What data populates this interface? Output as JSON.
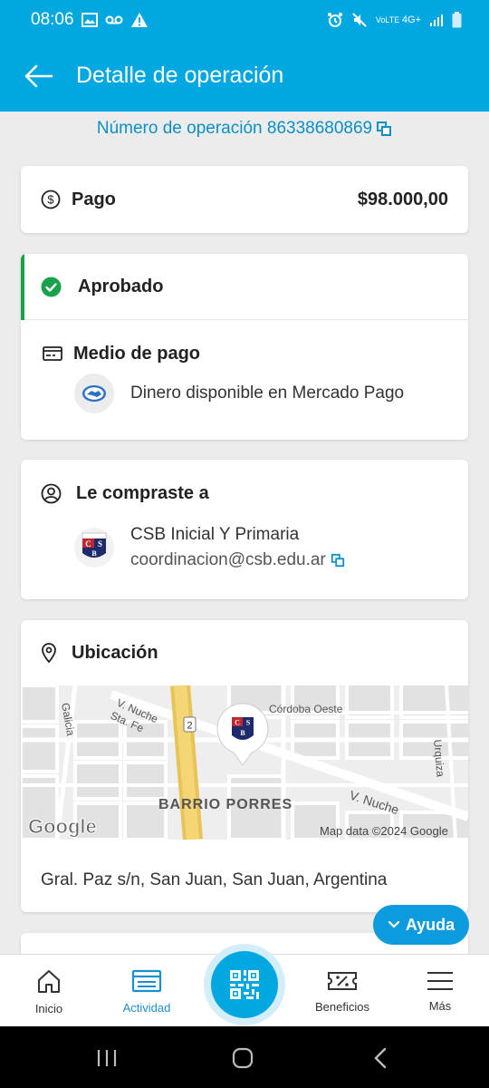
{
  "status_bar": {
    "time": "08:06",
    "network": "4G+",
    "volte": "VoLTE"
  },
  "header": {
    "title": "Detalle de operación"
  },
  "operation": {
    "number_text": "Número de operación 86338680869"
  },
  "payment": {
    "label": "Pago",
    "amount": "$98.000,00"
  },
  "status": {
    "label": "Aprobado",
    "method_title": "Medio de pago",
    "method_value": "Dinero disponible en Mercado Pago"
  },
  "seller": {
    "title": "Le compraste a",
    "name": "CSB Inicial Y Primaria",
    "email": "coordinacion@csb.edu.ar",
    "logo_initials": "CSB"
  },
  "location": {
    "title": "Ubicación",
    "address": "Gral. Paz s/n, San Juan, San Juan, Argentina",
    "map": {
      "labels": {
        "galicia": "Galicia",
        "v_nuche_top": "V. Nuche",
        "sta_fe": "Sta. Fe",
        "route": "2",
        "cordoba": "Córdoba Oeste",
        "urquiza": "Urquiza",
        "barrio": "BARRIO PORRES",
        "v_nuche_bottom": "V. Nuche",
        "google": "Google",
        "attribution": "Map data ©2024 Google"
      }
    }
  },
  "help_button": {
    "label": "Ayuda"
  },
  "bottom_nav": {
    "items": [
      {
        "label": "Inicio",
        "icon": "home-icon"
      },
      {
        "label": "Actividad",
        "icon": "activity-icon"
      },
      {
        "label": "",
        "icon": "qr-icon"
      },
      {
        "label": "Beneficios",
        "icon": "ticket-icon"
      },
      {
        "label": "Más",
        "icon": "menu-icon"
      }
    ]
  },
  "colors": {
    "brand": "#00a7e1",
    "success": "#1aa24a",
    "link": "#0a8fc7"
  }
}
